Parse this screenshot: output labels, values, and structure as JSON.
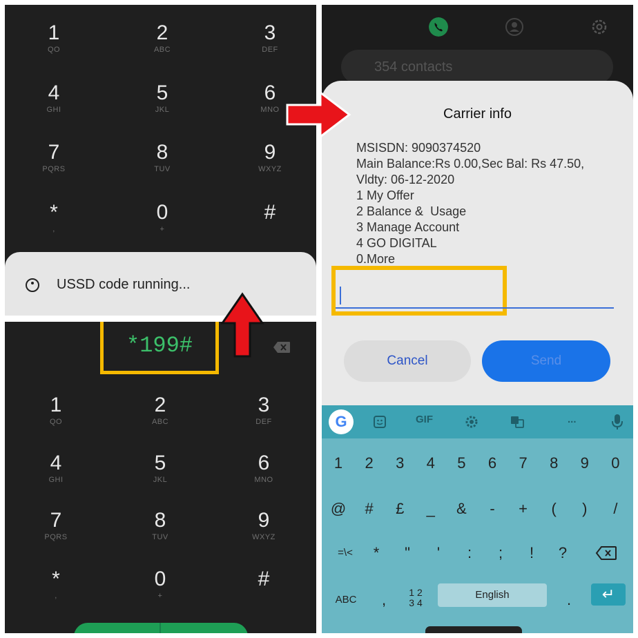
{
  "dialpad_top": {
    "keys": [
      {
        "digit": "1",
        "letters": "QO"
      },
      {
        "digit": "2",
        "letters": "ABC"
      },
      {
        "digit": "3",
        "letters": "DEF"
      },
      {
        "digit": "4",
        "letters": "GHI"
      },
      {
        "digit": "5",
        "letters": "JKL"
      },
      {
        "digit": "6",
        "letters": "MNO"
      },
      {
        "digit": "7",
        "letters": "PQRS"
      },
      {
        "digit": "8",
        "letters": "TUV"
      },
      {
        "digit": "9",
        "letters": "WXYZ"
      },
      {
        "digit": "*",
        "letters": ","
      },
      {
        "digit": "0",
        "letters": "+"
      },
      {
        "digit": "#",
        "letters": ""
      }
    ]
  },
  "ussd_sheet": {
    "status_text": "USSD code running..."
  },
  "dialer_bottom": {
    "entered_code": "*199#",
    "keys": [
      {
        "digit": "1",
        "letters": "QO"
      },
      {
        "digit": "2",
        "letters": "ABC"
      },
      {
        "digit": "3",
        "letters": "DEF"
      },
      {
        "digit": "4",
        "letters": "GHI"
      },
      {
        "digit": "5",
        "letters": "JKL"
      },
      {
        "digit": "6",
        "letters": "MNO"
      },
      {
        "digit": "7",
        "letters": "PQRS"
      },
      {
        "digit": "8",
        "letters": "TUV"
      },
      {
        "digit": "9",
        "letters": "WXYZ"
      },
      {
        "digit": "*",
        "letters": ","
      },
      {
        "digit": "0",
        "letters": "+"
      },
      {
        "digit": "#",
        "letters": ""
      }
    ]
  },
  "contacts": {
    "search_placeholder": "354 contacts"
  },
  "carrier_dialog": {
    "title": "Carrier info",
    "lines": [
      "MSISDN: 9090374520",
      "Main Balance:Rs 0.00,Sec Bal: Rs 47.50,",
      "Vldty: 06-12-2020",
      "1 My Offer",
      "2 Balance &  Usage",
      "3 Manage Account",
      "4 GO DIGITAL",
      "0.More"
    ],
    "input_value": "",
    "cancel_label": "Cancel",
    "send_label": "Send"
  },
  "keyboard": {
    "toolbar": {
      "google": "G",
      "gif": "GIF",
      "more": "..."
    },
    "row_numbers": [
      "1",
      "2",
      "3",
      "4",
      "5",
      "6",
      "7",
      "8",
      "9",
      "0"
    ],
    "row_symbols1": [
      "@",
      "#",
      "£",
      "_",
      "&",
      "-",
      "+",
      "(",
      ")",
      "/"
    ],
    "row_symbols2": [
      "=\\<",
      "*",
      "\"",
      "'",
      ":",
      ";",
      "!",
      "?"
    ],
    "abc_label": "ABC",
    "comma": ",",
    "numpad_label_top": "1 2",
    "numpad_label_bottom": "3 4",
    "space_label": "English",
    "period": ".",
    "enter_symbol": "↵"
  },
  "colors": {
    "highlight": "#f5b900",
    "arrow": "#e8141a",
    "code_green": "#3cc06a",
    "accent_blue": "#1a73e8",
    "keyboard_bg": "#6ab7c4"
  }
}
